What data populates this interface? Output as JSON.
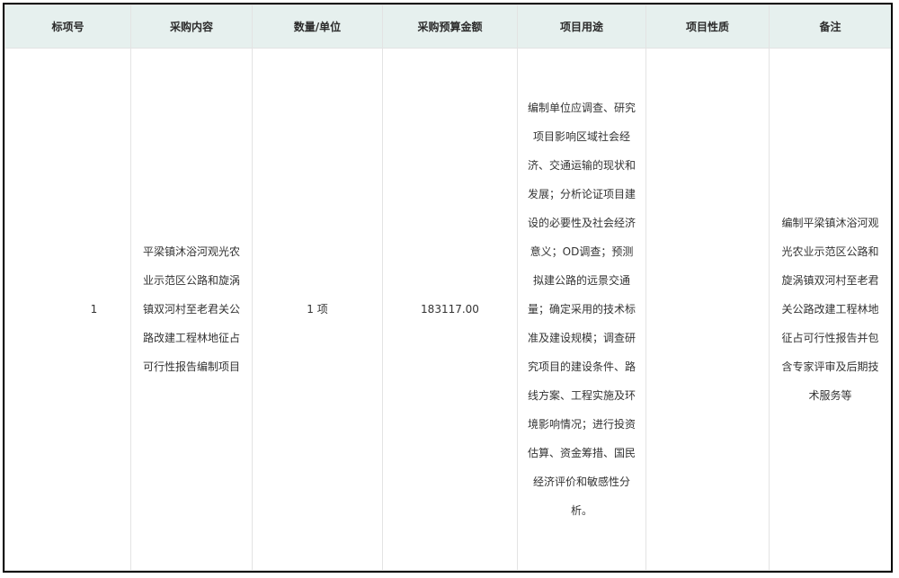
{
  "table": {
    "headers": [
      "标项号",
      "采购内容",
      "数量/单位",
      "采购预算金额",
      "项目用途",
      "项目性质",
      "备注"
    ],
    "rows": [
      {
        "lot_no": "1",
        "content": "平梁镇沐浴河观光农业示范区公路和旋涡镇双河村至老君关公路改建工程林地征占可行性报告编制项目",
        "quantity": "1 项",
        "budget": "183117.00",
        "purpose": "编制单位应调查、研究项目影响区域社会经济、交通运输的现状和发展；分析论证项目建设的必要性及社会经济意义；OD调查；预测拟建公路的远景交通量；确定采用的技术标准及建设规模；调查研究项目的建设条件、路线方案、工程实施及环境影响情况；进行投资估算、资金筹措、国民经济评价和敏感性分析。",
        "nature": "",
        "remark": "编制平梁镇沐浴河观光农业示范区公路和旋涡镇双河村至老君关公路改建工程林地征占可行性报告并包含专家评审及后期技术服务等"
      }
    ]
  }
}
